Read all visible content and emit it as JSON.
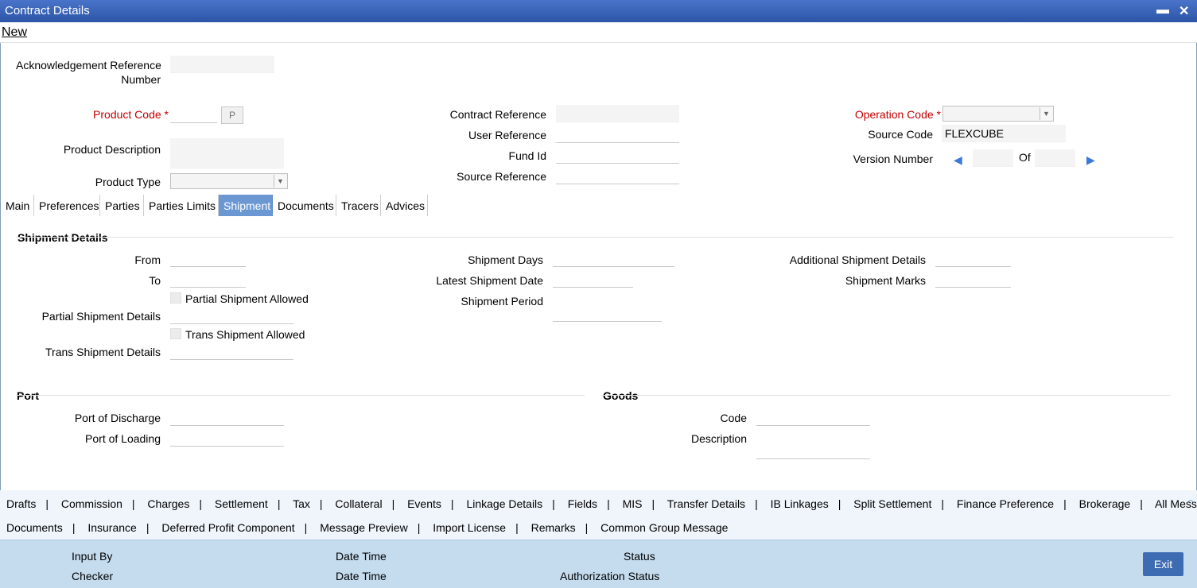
{
  "window": {
    "title": "Contract Details",
    "minimize": "▬",
    "close": "✕"
  },
  "menu": {
    "new": "New"
  },
  "header": {
    "ack_ref_label_line1": "Acknowledgement Reference",
    "ack_ref_label_line2": "Number",
    "ack_ref_value": "",
    "product_code_label": "Product Code",
    "product_code_value": "",
    "product_lookup_button": "P",
    "product_description_label": "Product Description",
    "product_description_value": "",
    "product_type_label": "Product Type",
    "product_type_value": "",
    "contract_reference_label": "Contract Reference",
    "contract_reference_value": "",
    "user_reference_label": "User Reference",
    "user_reference_value": "",
    "fund_id_label": "Fund Id",
    "fund_id_value": "",
    "source_reference_label": "Source Reference",
    "source_reference_value": "",
    "operation_code_label": "Operation Code",
    "operation_code_value": "",
    "source_code_label": "Source Code",
    "source_code_value": "FLEXCUBE",
    "version_number_label": "Version Number",
    "version_current": "",
    "version_of_label": "Of",
    "version_total": "",
    "required_mark": "*"
  },
  "tabs": [
    "Main",
    "Preferences",
    "Parties",
    "Parties Limits",
    "Shipment",
    "Documents",
    "Tracers",
    "Advices"
  ],
  "active_tab": "Shipment",
  "shipment": {
    "section_title": "Shipment Details",
    "from_label": "From",
    "from_value": "",
    "to_label": "To",
    "to_value": "",
    "partial_allowed_label": "Partial Shipment Allowed",
    "partial_allowed_checked": false,
    "partial_details_label": "Partial Shipment Details",
    "partial_details_value": "",
    "trans_allowed_label": "Trans Shipment Allowed",
    "trans_allowed_checked": false,
    "trans_details_label": "Trans Shipment Details",
    "trans_details_value": "",
    "shipment_days_label": "Shipment Days",
    "shipment_days_value": "",
    "latest_date_label": "Latest Shipment Date",
    "latest_date_value": "",
    "shipment_period_label": "Shipment Period",
    "shipment_period_value": "",
    "additional_details_label": "Additional Shipment Details",
    "additional_details_value": "",
    "shipment_marks_label": "Shipment Marks",
    "shipment_marks_value": ""
  },
  "port": {
    "section_title": "Port",
    "discharge_label": "Port of Discharge",
    "discharge_value": "",
    "loading_label": "Port of Loading",
    "loading_value": ""
  },
  "goods": {
    "section_title": "Goods",
    "code_label": "Code",
    "code_value": "",
    "description_label": "Description",
    "description_value": ""
  },
  "sub_links_row1": [
    "Drafts",
    "Commission",
    "Charges",
    "Settlement",
    "Tax",
    "Collateral",
    "Events",
    "Linkage Details",
    "Fields",
    "MIS",
    "Transfer Details",
    "IB Linkages",
    "Split Settlement",
    "Finance Preference",
    "Brokerage",
    "All Messages"
  ],
  "sub_links_row2": [
    "Documents",
    "Insurance",
    "Deferred Profit Component",
    "Message Preview",
    "Import License",
    "Remarks",
    "Common Group Message"
  ],
  "footer": {
    "input_by_label": "Input By",
    "checker_label": "Checker",
    "date_time_label_1": "Date Time",
    "date_time_label_2": "Date Time",
    "status_label": "Status",
    "authorization_status_label": "Authorization Status",
    "exit_button": "Exit"
  },
  "colors": {
    "title_bar": "#2c55a8",
    "active_tab": "#6b98d3",
    "required_label": "#c00000",
    "footer_bg": "#c5dcef",
    "exit_button": "#3e6cb2"
  }
}
